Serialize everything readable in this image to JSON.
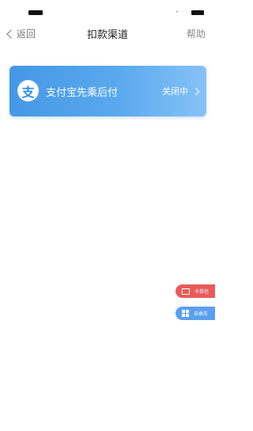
{
  "nav": {
    "back_label": "返回",
    "title": "扣款渠道",
    "help_label": "帮助"
  },
  "channel_card": {
    "logo_glyph": "支",
    "title": "支付宝先乘后付",
    "status": "关闭中"
  },
  "floating_buttons": {
    "card_label": "卡券包",
    "qr_label": "去乘车"
  },
  "colors": {
    "card_gradient_start": "#4598e6",
    "card_gradient_end": "#86c2f7",
    "float_card_bg": "#e95b5b",
    "float_qr_bg": "#5b9ff0"
  }
}
